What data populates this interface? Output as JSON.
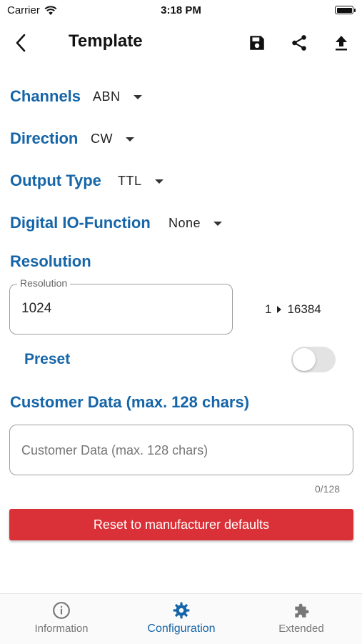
{
  "status_bar": {
    "carrier": "Carrier",
    "time": "3:18 PM"
  },
  "top_bar": {
    "title": "Template"
  },
  "channels": {
    "label": "Channels",
    "value": "ABN"
  },
  "direction": {
    "label": "Direction",
    "value": "CW"
  },
  "output_type": {
    "label": "Output Type",
    "value": "TTL"
  },
  "digital_io": {
    "label": "Digital IO-Function",
    "value": "None"
  },
  "resolution": {
    "section_label": "Resolution",
    "field_label": "Resolution",
    "value": "1024",
    "range_min": "1",
    "range_max": "16384"
  },
  "preset": {
    "label": "Preset",
    "enabled": false
  },
  "customer_data": {
    "section_label": "Customer Data (max. 128 chars)",
    "placeholder": "Customer Data (max. 128 chars)",
    "value": "",
    "counter": "0/128"
  },
  "reset_button": {
    "label": "Reset to manufacturer defaults"
  },
  "bottom_nav": {
    "items": [
      {
        "label": "Information",
        "icon": "info-icon",
        "active": false
      },
      {
        "label": "Configuration",
        "icon": "gear-icon",
        "active": true
      },
      {
        "label": "Extended",
        "icon": "puzzle-icon",
        "active": false
      }
    ]
  },
  "colors": {
    "accent": "#1565a8",
    "danger": "#d93137",
    "toggle_off": "#e3e3e3"
  }
}
